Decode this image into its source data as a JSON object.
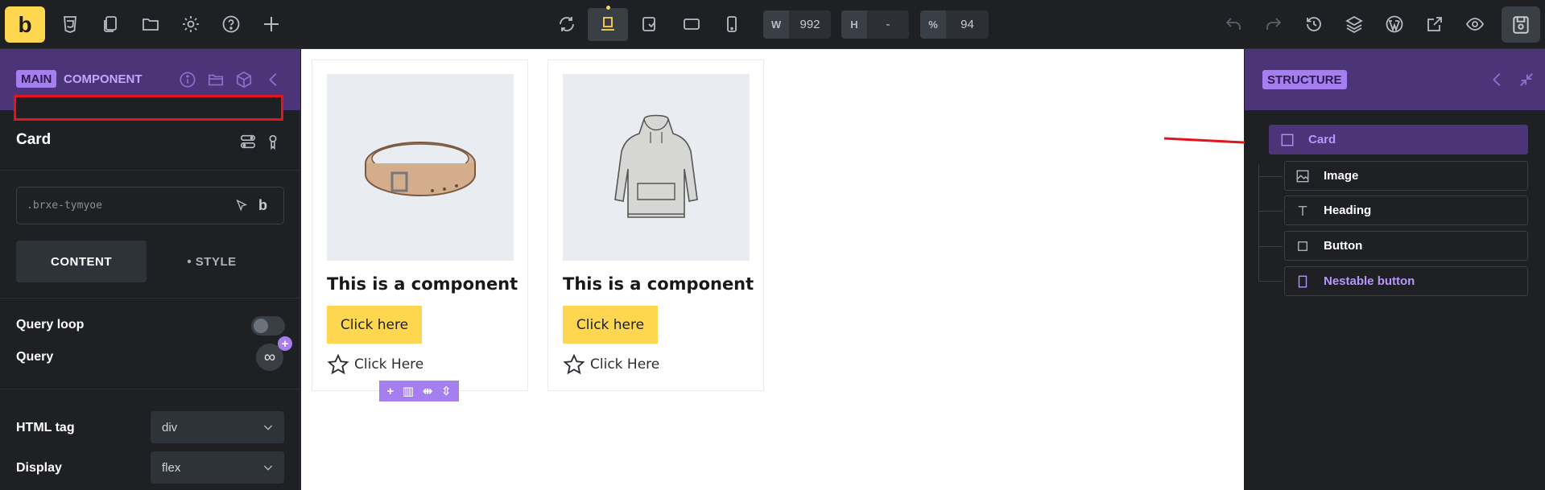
{
  "topbar": {
    "logo_letter": "b",
    "width_label": "W",
    "width_value": "992",
    "height_label": "H",
    "height_value": "-",
    "zoom_label": "%",
    "zoom_value": "94"
  },
  "left_panel": {
    "mode_pill": "MAIN",
    "mode_label": "COMPONENT",
    "element_name": "Card",
    "class_placeholder": ".brxe-tymyoe",
    "tabs": {
      "content": "CONTENT",
      "style": "• STYLE"
    },
    "fields": {
      "query_loop": "Query loop",
      "query": "Query",
      "query_symbol": "∞",
      "html_tag_label": "HTML tag",
      "html_tag_value": "div",
      "display_label": "Display",
      "display_value": "flex"
    }
  },
  "canvas": {
    "cards": [
      {
        "heading": "This is a component",
        "button": "Click here",
        "nested_button": "Click Here",
        "image_icon": "belt-image"
      },
      {
        "heading": "This is a component",
        "button": "Click here",
        "nested_button": "Click Here",
        "image_icon": "hoodie-image"
      }
    ],
    "toolbar_icons": [
      "+",
      "▥",
      "⇹",
      "⇳"
    ]
  },
  "structure_panel": {
    "title": "STRUCTURE",
    "items": [
      {
        "label": "Card",
        "icon": "square-icon",
        "selected": true
      },
      {
        "label": "Image",
        "icon": "image-icon"
      },
      {
        "label": "Heading",
        "icon": "text-icon"
      },
      {
        "label": "Button",
        "icon": "button-icon"
      },
      {
        "label": "Nestable button",
        "icon": "nestable-icon"
      }
    ]
  },
  "colors": {
    "accent": "#ffd64f",
    "purple": "#a57ff0",
    "panel_head": "#4b3478",
    "annotation": "#e4131c"
  }
}
